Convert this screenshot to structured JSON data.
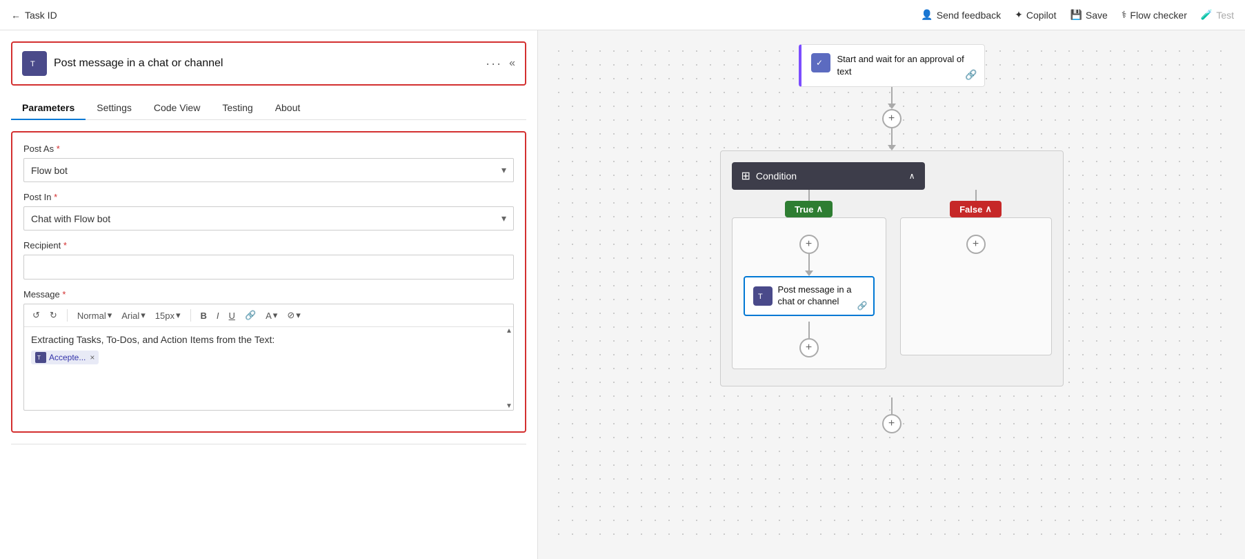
{
  "topbar": {
    "back_icon": "←",
    "title": "Task ID",
    "send_feedback_label": "Send feedback",
    "copilot_label": "Copilot",
    "save_label": "Save",
    "flow_checker_label": "Flow checker",
    "test_label": "Test"
  },
  "left_panel": {
    "action_header": {
      "title": "Post message in a chat or channel",
      "menu_icon": "···",
      "collapse_icon": "«"
    },
    "tabs": [
      {
        "label": "Parameters",
        "active": true
      },
      {
        "label": "Settings",
        "active": false
      },
      {
        "label": "Code View",
        "active": false
      },
      {
        "label": "Testing",
        "active": false
      },
      {
        "label": "About",
        "active": false
      }
    ],
    "form": {
      "post_as_label": "Post As",
      "post_as_value": "Flow bot",
      "post_in_label": "Post In",
      "post_in_value": "Chat with Flow bot",
      "recipient_label": "Recipient",
      "recipient_placeholder": "",
      "message_label": "Message",
      "toolbar": {
        "undo": "↺",
        "redo": "↻",
        "format": "Normal",
        "font": "Arial",
        "size": "15px",
        "bold": "B",
        "italic": "I",
        "underline": "U",
        "link": "🔗",
        "font_color": "A",
        "highlight": "⊘"
      },
      "message_text": "Extracting Tasks, To-Dos, and Action Items from the Text:",
      "message_tag": "Accepte...",
      "message_tag_icon": "✕"
    }
  },
  "right_panel": {
    "approval_block": {
      "title": "Start and wait for an approval of text"
    },
    "condition_block": {
      "title": "Condition"
    },
    "true_branch": {
      "label": "True",
      "teams_block_title": "Post message in a chat or channel"
    },
    "false_branch": {
      "label": "False"
    }
  }
}
